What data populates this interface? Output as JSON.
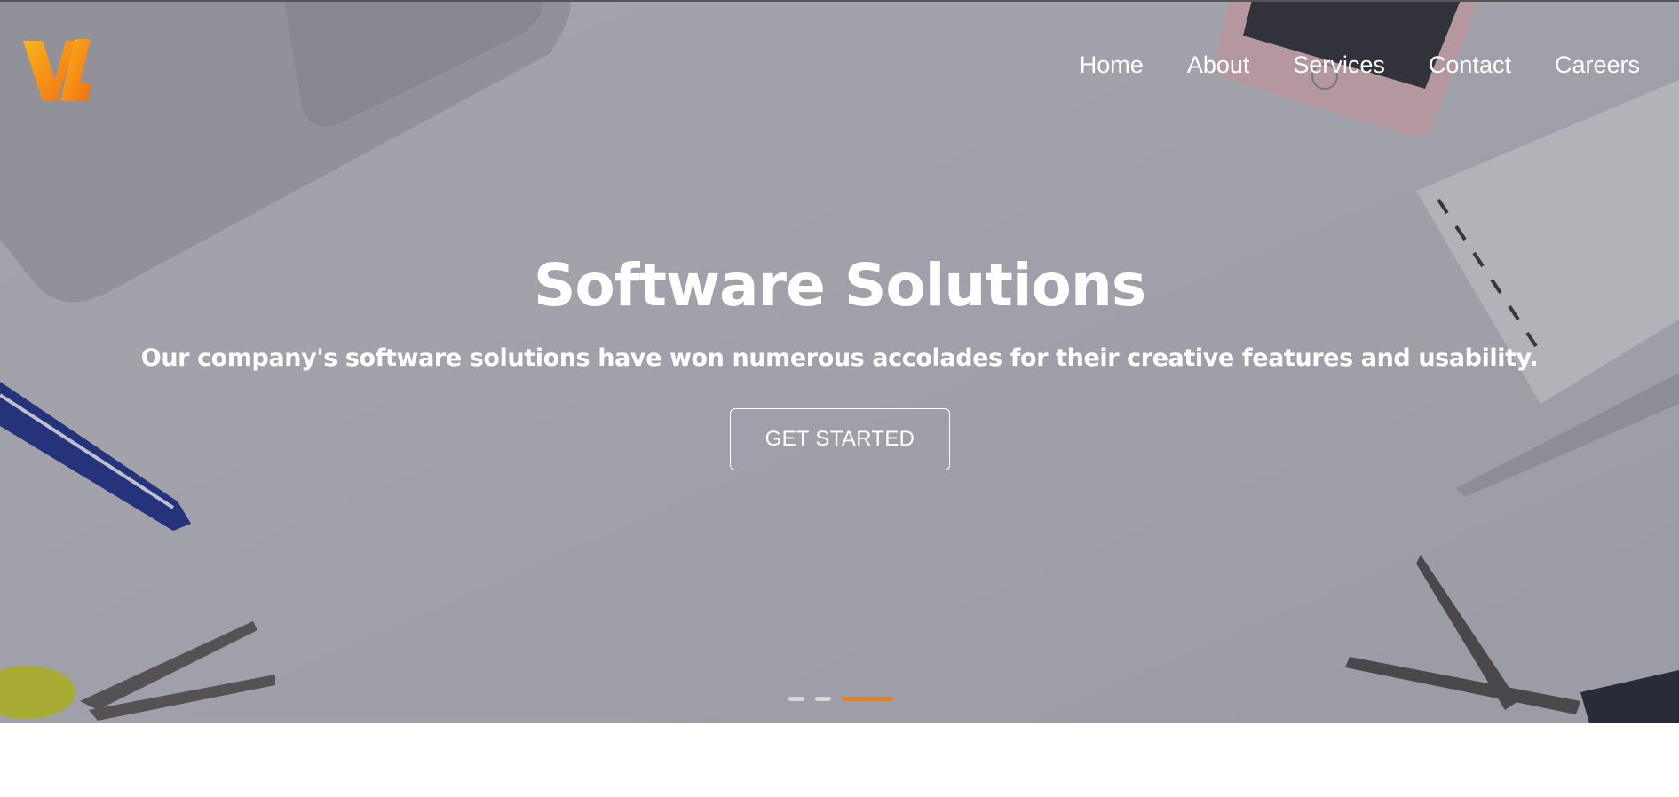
{
  "colors": {
    "accent": "#f47a10",
    "text_on_hero": "#ffffff",
    "indicator_inactive": "#d8d8d8",
    "logo_gradient_start": "#f9a51c",
    "logo_gradient_end": "#f47a10"
  },
  "header": {
    "logo_icon": "vl-logo-icon",
    "nav": [
      {
        "label": "Home"
      },
      {
        "label": "About"
      },
      {
        "label": "Services"
      },
      {
        "label": "Contact"
      },
      {
        "label": "Careers"
      }
    ]
  },
  "hero": {
    "title": "Software Solutions",
    "subtitle": "Our company's software solutions have won numerous accolades for their creative features and usability.",
    "cta_label": "GET STARTED",
    "carousel": {
      "slide_count": 3,
      "active_index": 2
    }
  }
}
